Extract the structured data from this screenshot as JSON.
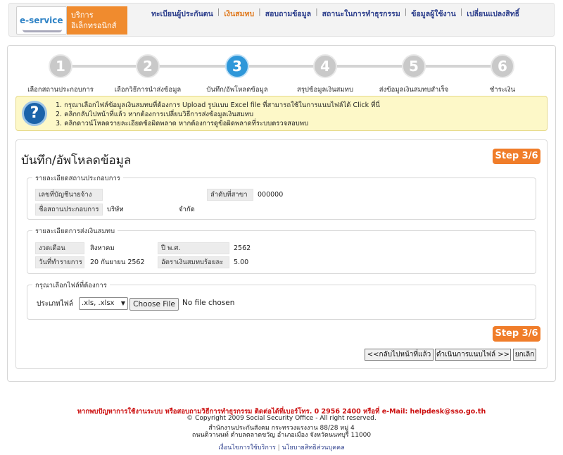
{
  "header": {
    "logo_text": "e-service",
    "brand_line1": "บริการ",
    "brand_line2": "อิเล็กทรอนิกส์",
    "nav": [
      "ทะเบียนผู้ประกันตน",
      "เงินสมทบ",
      "สอบถามข้อมูล",
      "สถานะในการทำธุรกรรม",
      "ข้อมูลผู้ใช้งาน",
      "เปลี่ยนแปลงสิทธิ์"
    ]
  },
  "steps": [
    {
      "num": "1",
      "label": "เลือกสถานประกอบการ"
    },
    {
      "num": "2",
      "label": "เลือกวิธีการนำส่งข้อมูล"
    },
    {
      "num": "3",
      "label": "บันทึก/อัพโหลดข้อมูล"
    },
    {
      "num": "4",
      "label": "สรุปข้อมูลเงินสมทบ"
    },
    {
      "num": "5",
      "label": "ส่งข้อมูลเงินสมทบสำเร็จ"
    },
    {
      "num": "6",
      "label": "ชำระเงิน"
    }
  ],
  "info": {
    "lines": [
      "1. กรุณาเลือกไฟล์ข้อมูลเงินสมทบที่ต้องการ Upload รูปแบบ Excel file ที่สามารถใช้ในการแนบไฟล์ได้ Click ที่นี่",
      "2. คลิกกลับไปหน้าที่แล้ว หากต้องการเปลี่ยนวิธีการส่งข้อมูลเงินสมทบ",
      "3. คลิกดาวน์โหลดรายละเอียดข้อผิดพลาด หากต้องการดูข้อผิดพลาดที่ระบบตรวจสอบพบ"
    ]
  },
  "main": {
    "title": "บันทึก/อัพโหลดข้อมูล",
    "step_badge": "Step 3/6"
  },
  "establishment": {
    "legend": "รายละเอียดสถานประกอบการ",
    "account_label": "เลขที่บัญชีนายจ้าง",
    "account_value": "",
    "branch_label": "ลำดับที่สาขา",
    "branch_value": "000000",
    "name_label": "ชื่อสถานประกอบการ",
    "name_prefix": "บริษัท",
    "name_suffix": "จำกัด"
  },
  "contribution": {
    "legend": "รายละเอียดการส่งเงินสมทบ",
    "period_label": "งวดเดือน",
    "period_value": "สิงหาคม",
    "year_label": "ปี พ.ศ.",
    "year_value": "2562",
    "date_label": "วันที่ทำรายการ",
    "date_value": "20 กันยายน 2562",
    "rate_label": "อัตราเงินสมทบร้อยละ",
    "rate_value": "5.00"
  },
  "file_select": {
    "legend": "กรุณาเลือกไฟล์ที่ต้องการ",
    "type_label": "ประเภทไฟล์",
    "type_value": ".xls, .xlsx",
    "choose_label": "Choose File",
    "no_file": "No file chosen"
  },
  "actions": {
    "back": "<<กลับไปหน้าที่แล้ว",
    "attach": "ดำเนินการแนบไฟล์ >>",
    "cancel": "ยกเลิก"
  },
  "footer": {
    "contact": "หากพบปัญหาการใช้งานระบบ หรือสอบถามวิธีการทำธุรกรรม ติดต่อได้ที่เบอร์โทร. 0 2956 2400 หรือที่ e-Mail: helpdesk@sso.go.th",
    "copyright": "© Copyright 2009 Social Security Office - All right reserved.",
    "address1": "สำนักงานประกันสังคม กระทรวงแรงงาน 88/28 หมู่ 4",
    "address2": "ถนนติวานนท์ ตำบลตลาดขวัญ อำเภอเมือง จังหวัดนนทบุรี 11000",
    "link_terms": "เงื่อนไขการใช้บริการ",
    "link_privacy": "นโยบายสิทธิส่วนบุคคล"
  }
}
